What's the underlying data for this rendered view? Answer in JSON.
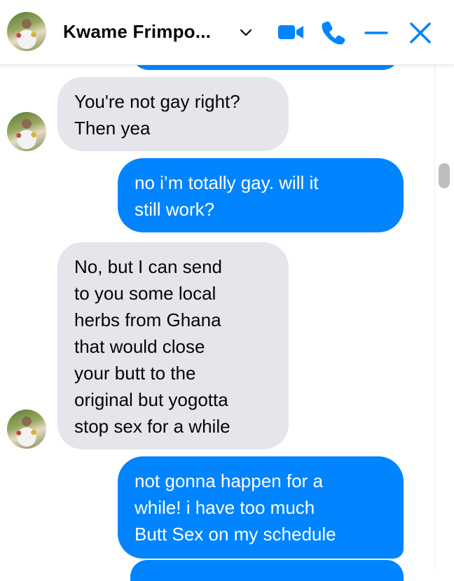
{
  "header": {
    "contact_name": "Kwame Frimpo...",
    "icons": [
      "chevron-down-icon",
      "video-call-icon",
      "phone-call-icon",
      "minimize-icon",
      "close-icon"
    ]
  },
  "colors": {
    "accent": "#0084ff",
    "incoming_bubble": "#e4e6eb",
    "incoming_text": "#050505",
    "outgoing_text": "#ffffff"
  },
  "messages": [
    {
      "direction": "incoming",
      "lines": [
        "You're not gay right?",
        "Then yea"
      ]
    },
    {
      "direction": "outgoing",
      "lines": [
        "no i’m totally gay. will it",
        "still work?"
      ]
    },
    {
      "direction": "incoming",
      "lines": [
        "No, but I can send",
        "to you some local",
        "herbs from Ghana",
        "that would close",
        "your butt to the",
        "original but yogotta",
        "stop sex for a while"
      ]
    },
    {
      "direction": "outgoing",
      "lines": [
        "not gonna happen for a",
        "while! i have too much",
        "Butt Sex on my schedule"
      ]
    }
  ]
}
